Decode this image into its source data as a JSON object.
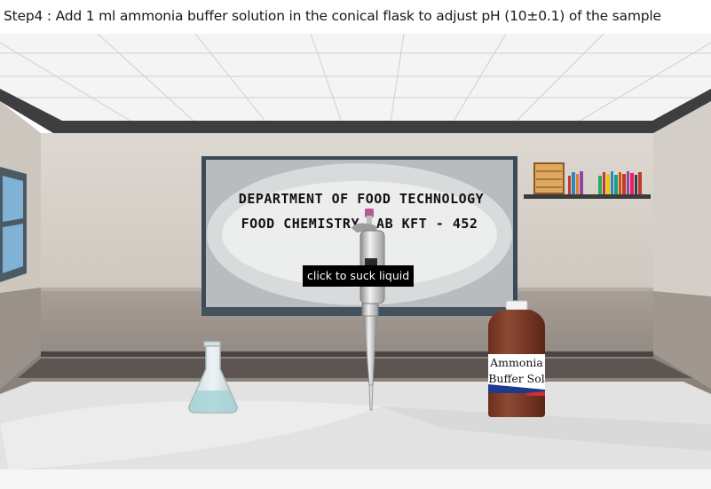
{
  "header": {
    "step_text": "Step4 : Add 1 ml ammonia buffer solution in the conical flask to adjust pH (10±0.1) of the sample"
  },
  "board": {
    "line1": "DEPARTMENT OF FOOD TECHNOLOGY",
    "line2": "FOOD CHEMISTRY LAB KFT - 452"
  },
  "pipette": {
    "tooltip": "click to suck liquid"
  },
  "bottle": {
    "label_line1": "Ammonia",
    "label_line2": "Buffer Sol"
  },
  "colors": {
    "wall": "#d8d3cc",
    "floor": "#9b928c",
    "bench": "#e6e6e6",
    "bottle": "#7a3a28"
  }
}
